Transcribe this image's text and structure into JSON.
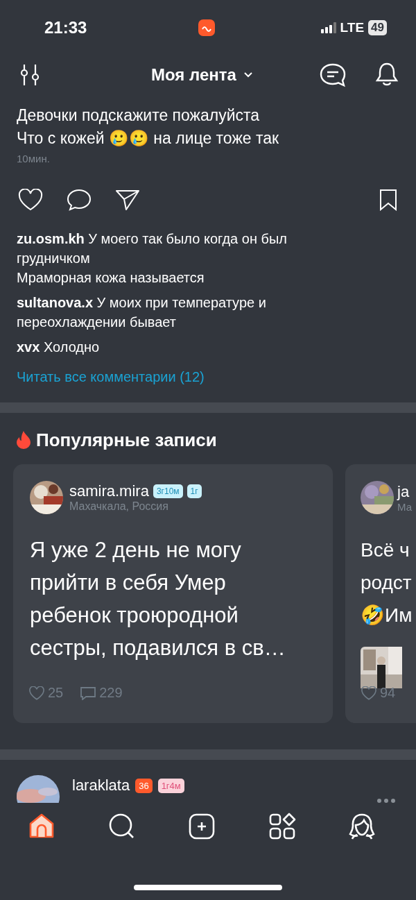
{
  "status_bar": {
    "time": "21:33",
    "network": "LTE",
    "battery": "49"
  },
  "header": {
    "title": "Моя лента"
  },
  "post": {
    "text_lines": [
      "Девочки подскажите пожалуйста",
      "Что с кожей 🥲🥲 на лице тоже так"
    ],
    "time": "10мин.",
    "liked": false,
    "bookmarked": false
  },
  "comments": [
    {
      "user": "zu.osm.kh",
      "text": "У моего так было когда он был грудничком\nМраморная кожа называется"
    },
    {
      "user": "sultanova.x",
      "text": "У моих при температуре и переохлаждении  бывает"
    },
    {
      "user": "xvx",
      "text": "Холодно"
    }
  ],
  "all_comments_link": "Читать все комментарии (12)",
  "popular": {
    "title": "Популярные записи",
    "cards": [
      {
        "user": "samira.mira",
        "location": "Махачкала, Россия",
        "badges": [
          {
            "text": "3г10м",
            "kind": "child"
          },
          {
            "text": "1г",
            "kind": "child"
          }
        ],
        "text_lines": [
          "Я уже 2 день не могу",
          "прийти в себя  Умер",
          "ребенок троюродной",
          "сестры, подавился в св…"
        ],
        "likes": "25",
        "comments": "229"
      },
      {
        "user": "ja",
        "location": "Ма",
        "text_lines": [
          "Всё ч",
          "родст",
          "🤣Им"
        ],
        "has_photo": true,
        "likes": "94"
      }
    ]
  },
  "next_post": {
    "user": "laraklata",
    "badges": [
      {
        "text": "36",
        "kind": "age"
      },
      {
        "text": "1г4м",
        "kind": "child_pink"
      }
    ]
  },
  "tab_bar": [
    {
      "kind": "home",
      "selected": true
    },
    {
      "kind": "search",
      "selected": false
    },
    {
      "kind": "add",
      "selected": false
    },
    {
      "kind": "apps",
      "selected": false
    },
    {
      "kind": "profile",
      "selected": false
    }
  ]
}
